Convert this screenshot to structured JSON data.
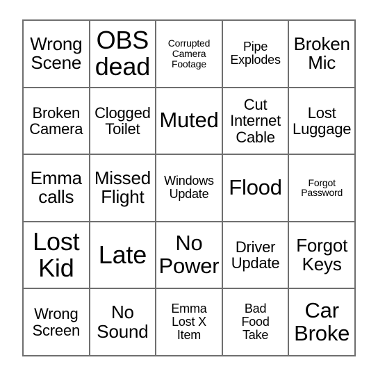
{
  "card": {
    "type": "bingo-card",
    "rows": 5,
    "columns": 5,
    "border_color": "#6f6f6f",
    "background_color": "#ffffff",
    "text_color": "#000000",
    "cells": [
      [
        {
          "text": "Wrong\nScene",
          "size": "lg"
        },
        {
          "text": "OBS\ndead",
          "size": "xxl"
        },
        {
          "text": "Corrupted\nCamera\nFootage",
          "size": "xs"
        },
        {
          "text": "Pipe\nExplodes",
          "size": "sm"
        },
        {
          "text": "Broken\nMic",
          "size": "lg"
        }
      ],
      [
        {
          "text": "Broken\nCamera",
          "size": "md"
        },
        {
          "text": "Clogged\nToilet",
          "size": "md"
        },
        {
          "text": "Muted",
          "size": "xl"
        },
        {
          "text": "Cut\nInternet\nCable",
          "size": "md"
        },
        {
          "text": "Lost\nLuggage",
          "size": "md"
        }
      ],
      [
        {
          "text": "Emma\ncalls",
          "size": "lg"
        },
        {
          "text": "Missed\nFlight",
          "size": "lg"
        },
        {
          "text": "Windows\nUpdate",
          "size": "sm"
        },
        {
          "text": "Flood",
          "size": "xl"
        },
        {
          "text": "Forgot\nPassword",
          "size": "xs"
        }
      ],
      [
        {
          "text": "Lost\nKid",
          "size": "xxl"
        },
        {
          "text": "Late",
          "size": "xxl"
        },
        {
          "text": "No\nPower",
          "size": "xl"
        },
        {
          "text": "Driver\nUpdate",
          "size": "md"
        },
        {
          "text": "Forgot\nKeys",
          "size": "lg"
        }
      ],
      [
        {
          "text": "Wrong\nScreen",
          "size": "md"
        },
        {
          "text": "No\nSound",
          "size": "lg"
        },
        {
          "text": "Emma\nLost X\nItem",
          "size": "sm"
        },
        {
          "text": "Bad\nFood\nTake",
          "size": "sm"
        },
        {
          "text": "Car\nBroke",
          "size": "xl"
        }
      ]
    ]
  }
}
